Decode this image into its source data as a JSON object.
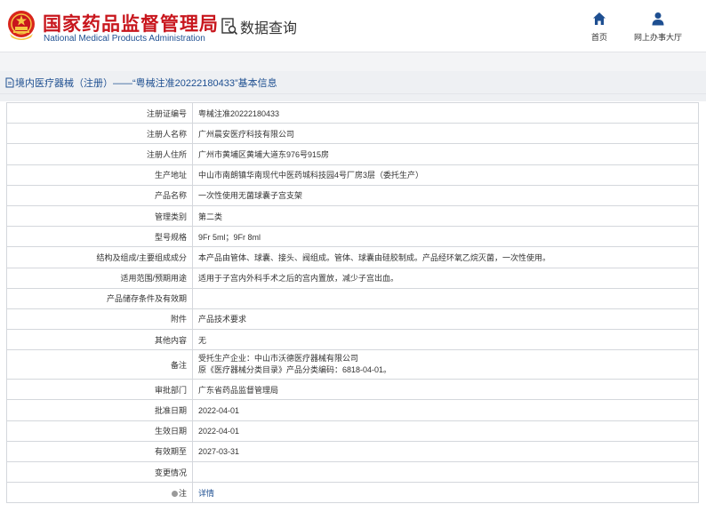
{
  "header": {
    "brand_cn": "国家药品监督管理局",
    "brand_en": "National Medical Products Administration",
    "query_label": "数据查询",
    "nav": [
      {
        "label": "首页",
        "icon": "home-icon"
      },
      {
        "label": "网上办事大厅",
        "icon": "user-icon"
      }
    ]
  },
  "title": "境内医疗器械（注册）——“粤械注准20222180433”基本信息",
  "rows": [
    {
      "label": "注册证编号",
      "value": "粤械注准20222180433"
    },
    {
      "label": "注册人名称",
      "value": "广州晨安医疗科技有限公司"
    },
    {
      "label": "注册人住所",
      "value": "广州市黄埔区黄埔大道东976号915房"
    },
    {
      "label": "生产地址",
      "value": "中山市南朗镇华南现代中医药城科技园4号厂房3层（委托生产）"
    },
    {
      "label": "产品名称",
      "value": "一次性使用无菌球囊子宫支架"
    },
    {
      "label": "管理类别",
      "value": "第二类"
    },
    {
      "label": "型号规格",
      "value": "9Fr 5ml；9Fr 8ml"
    },
    {
      "label": "结构及组成/主要组成成分",
      "value": "本产品由管体、球囊、接头、阀组成。管体、球囊由硅胶制成。产品经环氧乙烷灭菌，一次性使用。"
    },
    {
      "label": "适用范围/预期用途",
      "value": "适用于子宫内外科手术之后的宫内置放，减少子宫出血。"
    },
    {
      "label": "产品储存条件及有效期",
      "value": ""
    },
    {
      "label": "附件",
      "value": "产品技术要求"
    },
    {
      "label": "其他内容",
      "value": "无"
    },
    {
      "label": "备注",
      "value_lines": [
        "受托生产企业：中山市沃德医疗器械有限公司",
        "原《医疗器械分类目录》产品分类编码：6818-04-01。"
      ]
    },
    {
      "label": "审批部门",
      "value": "广东省药品监督管理局"
    },
    {
      "label": "批准日期",
      "value": "2022-04-01"
    },
    {
      "label": "生效日期",
      "value": "2022-04-01"
    },
    {
      "label": "有效期至",
      "value": "2027-03-31"
    },
    {
      "label": "变更情况",
      "value": ""
    },
    {
      "label": "注",
      "value": "详情"
    }
  ],
  "colors": {
    "brand_red": "#c8161d",
    "brand_blue": "#1e4f91"
  }
}
